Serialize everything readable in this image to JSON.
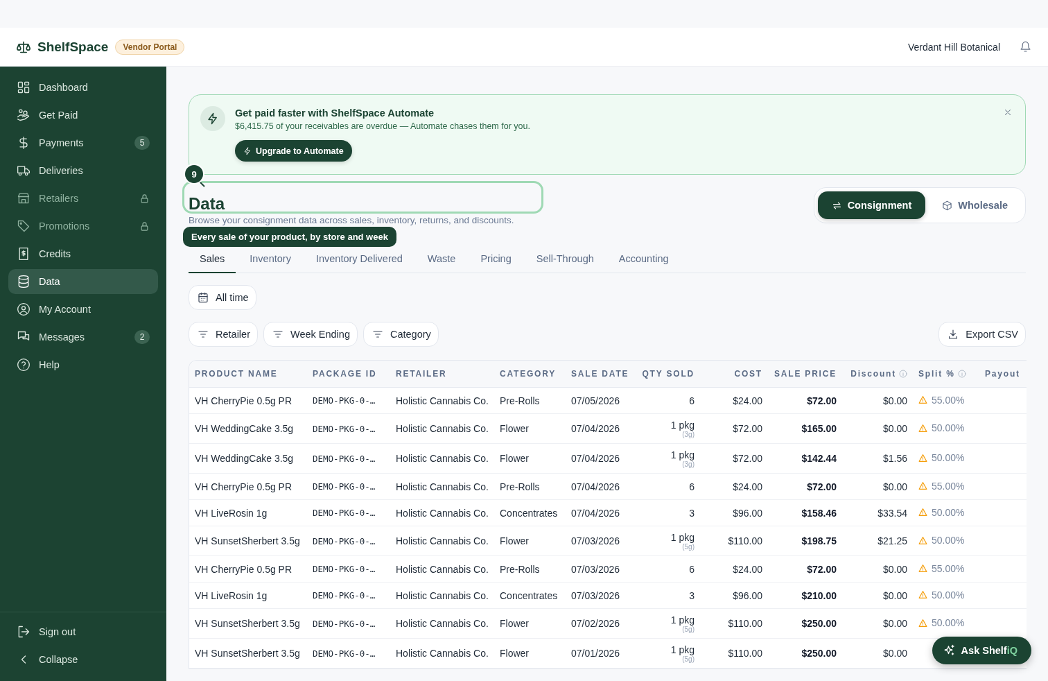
{
  "header": {
    "brand": "ShelfSpace",
    "badge": "Vendor Portal",
    "account": "Verdant Hill Botanical"
  },
  "sidebar": {
    "items": [
      {
        "label": "Dashboard",
        "selected": false,
        "locked": false
      },
      {
        "label": "Get Paid",
        "selected": false,
        "locked": false
      },
      {
        "label": "Payments",
        "selected": false,
        "locked": false,
        "badge": "5"
      },
      {
        "label": "Deliveries",
        "selected": false,
        "locked": false
      },
      {
        "label": "Retailers",
        "selected": false,
        "locked": true
      },
      {
        "label": "Promotions",
        "selected": false,
        "locked": true
      },
      {
        "label": "Credits",
        "selected": false,
        "locked": false
      },
      {
        "label": "Data",
        "selected": true,
        "locked": false
      },
      {
        "label": "My Account",
        "selected": false,
        "locked": false
      },
      {
        "label": "Messages",
        "selected": false,
        "locked": false,
        "badge": "2"
      },
      {
        "label": "Help",
        "selected": false,
        "locked": false
      }
    ],
    "footer": [
      "Sign out",
      "Collapse"
    ]
  },
  "banner": {
    "title": "Get paid faster with ShelfSpace Automate",
    "message": "$6,415.75 of your receivables are overdue — Automate chases them for you.",
    "button": "Upgrade to Automate"
  },
  "page": {
    "title": "Data",
    "subtitle": "Browse your consignment data across sales, inventory, returns, and discounts."
  },
  "tour": {
    "step": "9",
    "tip": "Every sale of your product, by store and week"
  },
  "mode_toggle": [
    {
      "label": "Consignment",
      "selected": true
    },
    {
      "label": "Wholesale",
      "selected": false
    }
  ],
  "tabs": [
    {
      "label": "Sales",
      "selected": true
    },
    {
      "label": "Inventory",
      "selected": false
    },
    {
      "label": "Inventory Delivered",
      "selected": false
    },
    {
      "label": "Waste",
      "selected": false
    },
    {
      "label": "Pricing",
      "selected": false
    },
    {
      "label": "Sell-Through",
      "selected": false
    },
    {
      "label": "Accounting",
      "selected": false
    }
  ],
  "date_filter": "All time",
  "filters": [
    "Retailer",
    "Week Ending",
    "Category"
  ],
  "export": "Export CSV",
  "table": {
    "columns": [
      {
        "label": "PRODUCT NAME",
        "info": false
      },
      {
        "label": "PACKAGE ID",
        "info": false
      },
      {
        "label": "RETAILER",
        "info": false
      },
      {
        "label": "CATEGORY",
        "info": false
      },
      {
        "label": "SALE DATE",
        "info": false
      },
      {
        "label": "QTY SOLD",
        "info": false
      },
      {
        "label": "COST",
        "info": false
      },
      {
        "label": "SALE PRICE",
        "info": false
      },
      {
        "label": "Discount",
        "info": true
      },
      {
        "label": "Split %",
        "info": true
      },
      {
        "label": "Payout",
        "info": false
      }
    ],
    "rows": [
      {
        "product": "VH CherryPie 0.5g PR",
        "package_id": "DEMO-PKG-0-…",
        "retailer": "Holistic Cannabis Co.",
        "category": "Pre-Rolls",
        "sale_date": "07/05/2026",
        "qty": "6",
        "cost": "$24.00",
        "sale_price": "$72.00",
        "discount": "$0.00",
        "split": "55.00%"
      },
      {
        "product": "VH WeddingCake 3.5g",
        "package_id": "DEMO-PKG-0-…",
        "retailer": "Holistic Cannabis Co.",
        "category": "Flower",
        "sale_date": "07/04/2026",
        "qty": "1 pkg",
        "qty_note": "(3g)",
        "cost": "$72.00",
        "sale_price": "$165.00",
        "discount": "$0.00",
        "split": "50.00%"
      },
      {
        "product": "VH WeddingCake 3.5g",
        "package_id": "DEMO-PKG-0-…",
        "retailer": "Holistic Cannabis Co.",
        "category": "Flower",
        "sale_date": "07/04/2026",
        "qty": "1 pkg",
        "qty_note": "(3g)",
        "cost": "$72.00",
        "sale_price": "$142.44",
        "discount": "$1.56",
        "split": "50.00%"
      },
      {
        "product": "VH CherryPie 0.5g PR",
        "package_id": "DEMO-PKG-0-…",
        "retailer": "Holistic Cannabis Co.",
        "category": "Pre-Rolls",
        "sale_date": "07/04/2026",
        "qty": "6",
        "cost": "$24.00",
        "sale_price": "$72.00",
        "discount": "$0.00",
        "split": "55.00%"
      },
      {
        "product": "VH LiveRosin 1g",
        "package_id": "DEMO-PKG-0-…",
        "retailer": "Holistic Cannabis Co.",
        "category": "Concentrates",
        "sale_date": "07/04/2026",
        "qty": "3",
        "cost": "$96.00",
        "sale_price": "$158.46",
        "discount": "$33.54",
        "split": "50.00%"
      },
      {
        "product": "VH SunsetSherbert 3.5g",
        "package_id": "DEMO-PKG-0-…",
        "retailer": "Holistic Cannabis Co.",
        "category": "Flower",
        "sale_date": "07/03/2026",
        "qty": "1 pkg",
        "qty_note": "(5g)",
        "cost": "$110.00",
        "sale_price": "$198.75",
        "discount": "$21.25",
        "split": "50.00%"
      },
      {
        "product": "VH CherryPie 0.5g PR",
        "package_id": "DEMO-PKG-0-…",
        "retailer": "Holistic Cannabis Co.",
        "category": "Pre-Rolls",
        "sale_date": "07/03/2026",
        "qty": "6",
        "cost": "$24.00",
        "sale_price": "$72.00",
        "discount": "$0.00",
        "split": "55.00%"
      },
      {
        "product": "VH LiveRosin 1g",
        "package_id": "DEMO-PKG-0-…",
        "retailer": "Holistic Cannabis Co.",
        "category": "Concentrates",
        "sale_date": "07/03/2026",
        "qty": "3",
        "cost": "$96.00",
        "sale_price": "$210.00",
        "discount": "$0.00",
        "split": "50.00%"
      },
      {
        "product": "VH SunsetSherbert 3.5g",
        "package_id": "DEMO-PKG-0-…",
        "retailer": "Holistic Cannabis Co.",
        "category": "Flower",
        "sale_date": "07/02/2026",
        "qty": "1 pkg",
        "qty_note": "(5g)",
        "cost": "$110.00",
        "sale_price": "$250.00",
        "discount": "$0.00",
        "split": "50.00%"
      },
      {
        "product": "VH SunsetSherbert 3.5g",
        "package_id": "DEMO-PKG-0-…",
        "retailer": "Holistic Cannabis Co.",
        "category": "Flower",
        "sale_date": "07/01/2026",
        "qty": "1 pkg",
        "qty_note": "(5g)",
        "cost": "$110.00",
        "sale_price": "$250.00",
        "discount": "$0.00"
      }
    ]
  },
  "assistant": {
    "label": "Ask Shelf",
    "accent": "iQ"
  }
}
